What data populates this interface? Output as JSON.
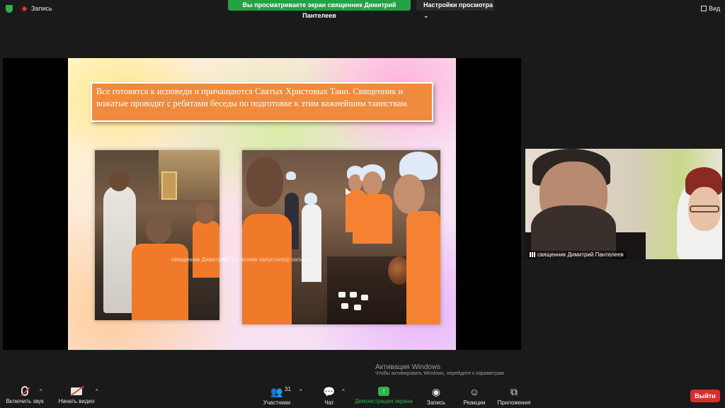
{
  "topbar": {
    "record_label": "Запись",
    "share_banner": "Вы просматриваете экран священник Димитрий Пантелеев",
    "view_options": "Настройки просмотра",
    "view_label": "Вид"
  },
  "slide": {
    "caption": "Все готовятся к исповеди и причащаются Святых Христовых Таин. Священник и вожатые проводят с ребятами беседы по подготовке к этим важнейшим таинствам.",
    "recording_overlay": "священник Димитрий Пантелеев запустил(а) запись",
    "watermark_title": "Активация Windows",
    "watermark_subtitle": "Чтобы активировать Windows, перейдите к параметрам"
  },
  "participant": {
    "name": "священник Димитрий Пантелеев"
  },
  "toolbar": {
    "audio_label": "Включить звук",
    "video_label": "Начать видео",
    "participants_label": "Участники",
    "participants_count": "31",
    "chat_label": "Чат",
    "share_label": "Демонстрация экрана",
    "record_label": "Запись",
    "reactions_label": "Реакции",
    "apps_label": "Приложения",
    "leave_label": "Выйти"
  },
  "colors": {
    "share_banner": "#25a244",
    "leave": "#d2312c",
    "caption_bg": "#f08a3c"
  }
}
